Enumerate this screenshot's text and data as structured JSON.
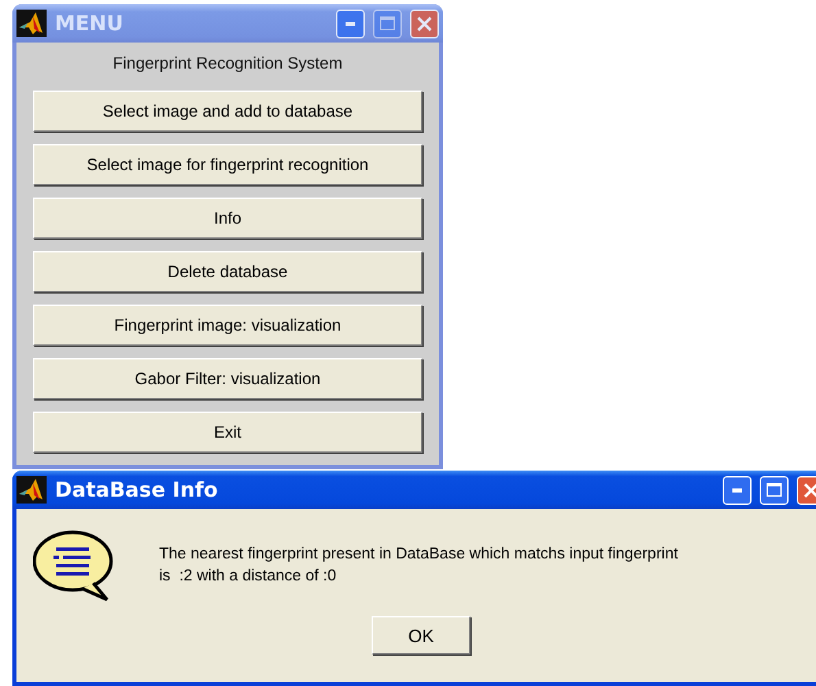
{
  "menu_window": {
    "title": "MENU",
    "active": false,
    "heading": "Fingerprint Recognition System",
    "buttons": [
      "Select image and add to database",
      "Select image for fingerprint recognition",
      "Info",
      "Delete database",
      "Fingerprint image: visualization",
      "Gabor Filter: visualization",
      "Exit"
    ]
  },
  "dialog": {
    "title": "DataBase Info",
    "active": true,
    "message_lines": [
      "The nearest fingerprint present in DataBase which matchs input fingerprint",
      "is  :2 with a distance of :0"
    ],
    "button": "OK"
  }
}
